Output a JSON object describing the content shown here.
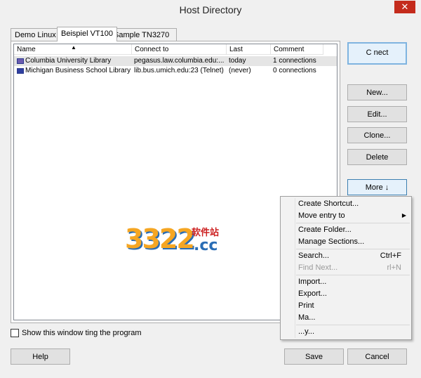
{
  "window": {
    "title": "Host Directory",
    "close_glyph": "✕"
  },
  "tabs": [
    {
      "label": "Demo Linux"
    },
    {
      "label": "Beispiel VT100"
    },
    {
      "label": "Sample TN3270"
    }
  ],
  "list": {
    "columns": [
      "Name",
      "Connect to",
      "Last Connect",
      "Comment"
    ],
    "sort_glyph": "▲",
    "rows": [
      {
        "name": "Columbia University Library",
        "connect_to": "pegasus.law.columbia.edu:...",
        "last_connect": "today",
        "comment": "1 connections",
        "icon": "host-icon-purple"
      },
      {
        "name": "Michigan Business School Library",
        "connect_to": "lib.bus.umich.edu:23 (Telnet)",
        "last_connect": "(never)",
        "comment": "0 connections",
        "icon": "host-icon-blue"
      }
    ]
  },
  "buttons": {
    "connect": "C    nect",
    "new": "New...",
    "edit": "Edit...",
    "clone": "Clone...",
    "delete": "Delete",
    "more": "More  ↓",
    "help": "Help",
    "save": "Save",
    "cancel": "Cancel"
  },
  "checkbox_label": "Show this window          ting the program",
  "context_menu": {
    "create_shortcut": "Create Shortcut...",
    "move_entry": "Move entry to",
    "create_folder": "Create Folder...",
    "manage_sections": "Manage Sections...",
    "search": "Search...",
    "search_shortcut": "Ctrl+F",
    "find_next": "Find Next...",
    "find_next_shortcut": "rl+N",
    "import": "Import...",
    "export": "Export...",
    "print": "Print",
    "more": "Ma...",
    "last": "...y..."
  },
  "watermark": {
    "number": "3322",
    "cc": ".cc",
    "cn": "软件站"
  },
  "colors": {
    "accent": "#3c7fb1",
    "close": "#c42b1c"
  }
}
